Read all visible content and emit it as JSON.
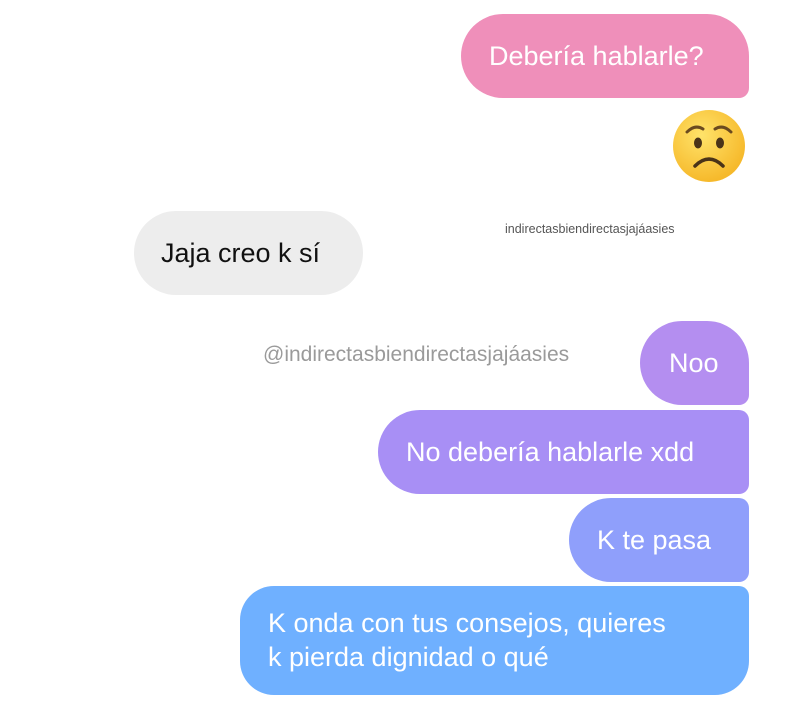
{
  "messages": [
    {
      "sender": "me",
      "text": "Debería hablarle?"
    },
    {
      "sender": "me",
      "emoji": "worried-face"
    },
    {
      "sender": "other",
      "text": "Jaja creo k sí"
    },
    {
      "sender": "me",
      "text": "Noo"
    },
    {
      "sender": "me",
      "text": "No debería hablarle xdd"
    },
    {
      "sender": "me",
      "text": "K te pasa"
    },
    {
      "sender": "me",
      "lines": [
        "K onda con tus consejos, quieres",
        "k pierda dignidad o qué"
      ]
    }
  ],
  "watermarks": {
    "small": "indirectasbiendirectasjajáasies",
    "large": "@indirectasbiendirectasjajáasies"
  },
  "colors": {
    "pink": "#ef8fba",
    "gray": "#ededed",
    "purple": "#b48ef0",
    "violet": "#a88ff5",
    "periwinkle": "#8f9ffb",
    "blue": "#6fb0ff",
    "emoji": "#ffcf3f"
  }
}
